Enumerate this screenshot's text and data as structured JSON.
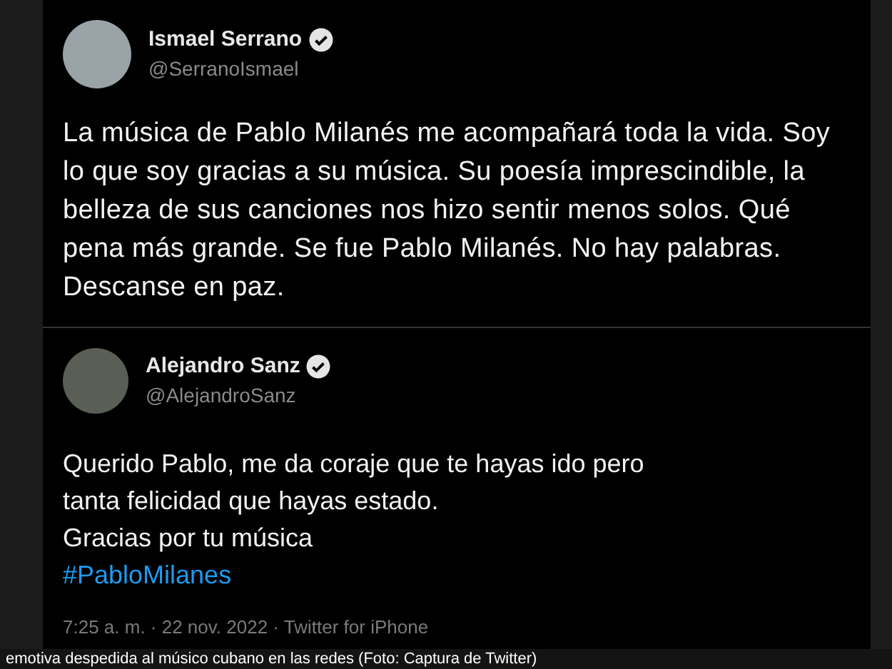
{
  "tweets": [
    {
      "name": "Ismael Serrano",
      "handle": "@SerranoIsmael",
      "verified": true,
      "lines": [
        "La música de Pablo Milanés me acompañará toda la vida. Soy lo que soy gracias a su música. Su poesía imprescindible, la belleza de sus canciones nos hizo sentir menos solos. Qué pena más grande. Se fue Pablo Milanés. No hay palabras. Descanse en paz."
      ]
    },
    {
      "name": "Alejandro Sanz",
      "handle": "@AlejandroSanz",
      "verified": true,
      "lines": [
        "Querido Pablo, me da coraje que te hayas ido pero tanta felicidad que hayas estado.",
        "Gracias por tu música"
      ],
      "hashtag": "#PabloMilanes",
      "meta": "7:25 a. m. · 22 nov. 2022 · Twitter for iPhone"
    }
  ],
  "caption": "emotiva despedida al músico cubano en las redes (Foto: Captura de Twitter)"
}
